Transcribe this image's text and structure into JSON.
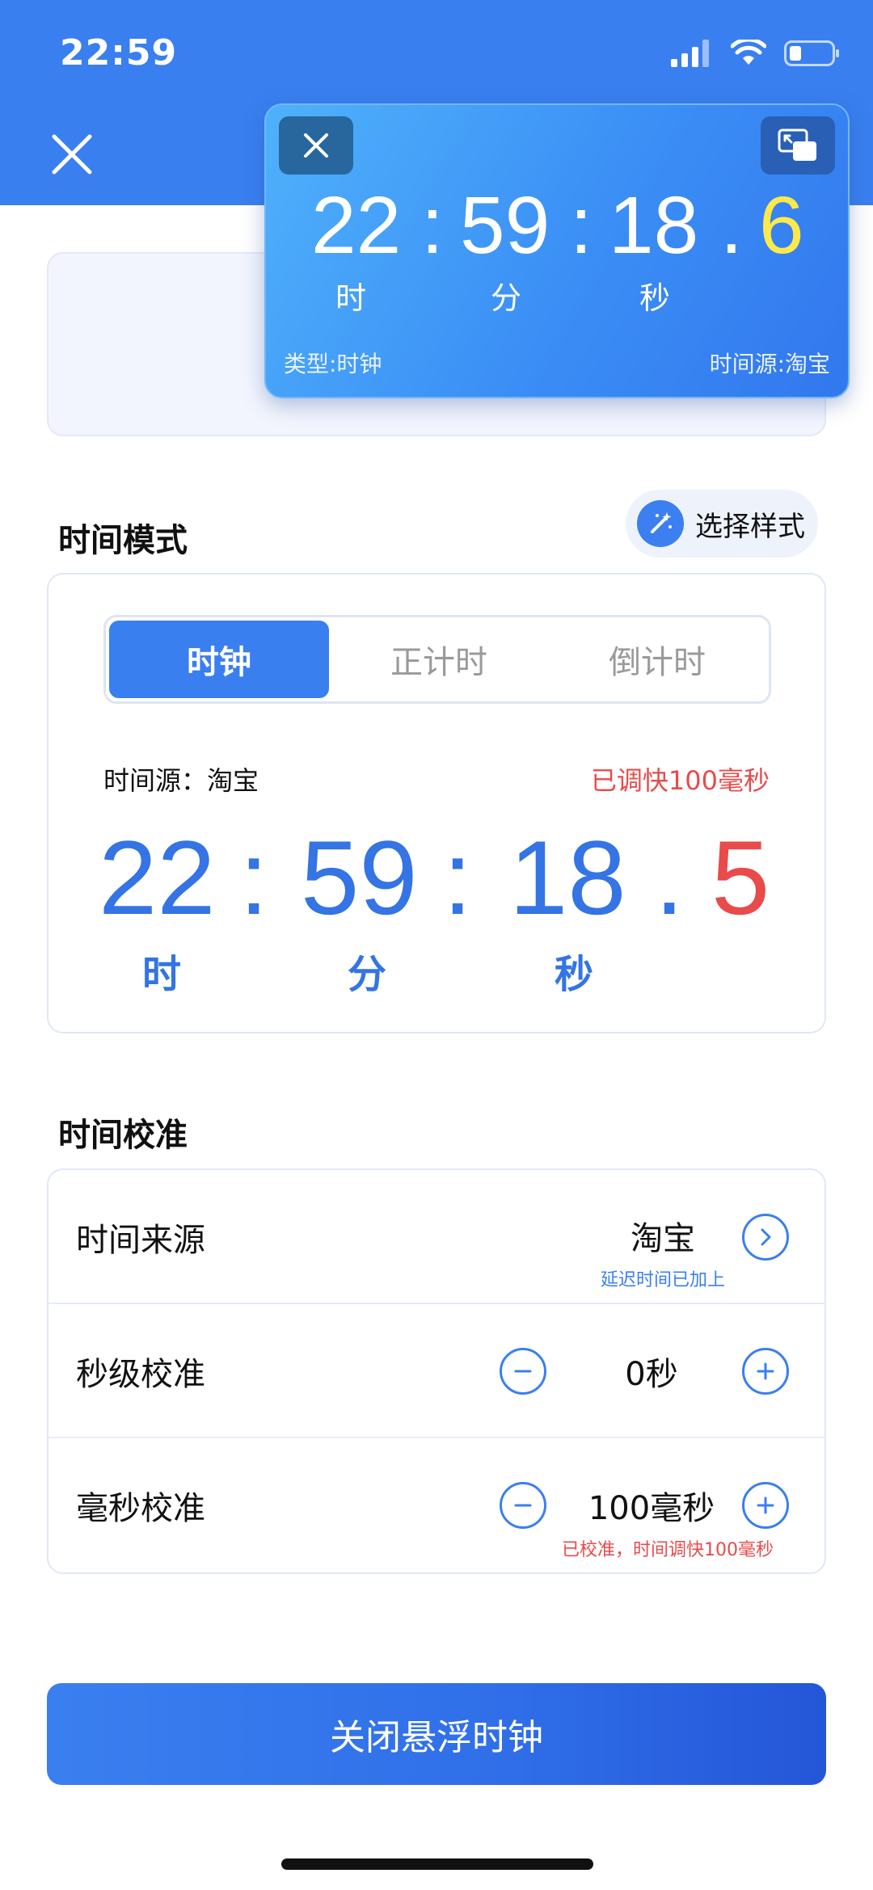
{
  "status_bar": {
    "time": "22:59"
  },
  "floating_clock": {
    "hours": "22",
    "minutes": "59",
    "seconds": "18",
    "tenths": "6",
    "separator": ":",
    "dot": ".",
    "unit_hour": "时",
    "unit_minute": "分",
    "unit_second": "秒",
    "type_label": "类型:时钟",
    "source_label": "时间源:淘宝",
    "tenths_color": "#ffe94a"
  },
  "time_mode": {
    "title": "时间模式",
    "style_button_label": "选择样式",
    "tabs": [
      {
        "label": "时钟",
        "active": true
      },
      {
        "label": "正计时",
        "active": false
      },
      {
        "label": "倒计时",
        "active": false
      }
    ],
    "source_text": "时间源：淘宝",
    "adjust_text": "已调快100毫秒",
    "hours": "22",
    "minutes": "59",
    "seconds": "18",
    "tenths": "5",
    "separator": ":",
    "dot": ".",
    "unit_hour": "时",
    "unit_minute": "分",
    "unit_second": "秒"
  },
  "calibration": {
    "title": "时间校准",
    "rows": [
      {
        "label": "时间来源",
        "value": "淘宝",
        "note": "延迟时间已加上"
      },
      {
        "label": "秒级校准",
        "value": "0秒"
      },
      {
        "label": "毫秒校准",
        "value": "100毫秒",
        "note": "已校准，时间调快100毫秒"
      }
    ]
  },
  "primary_button": {
    "label": "关闭悬浮时钟"
  },
  "colors": {
    "accent": "#3a7ff0",
    "digit_blue": "#3474e4",
    "warning_red": "#e94a4a"
  }
}
